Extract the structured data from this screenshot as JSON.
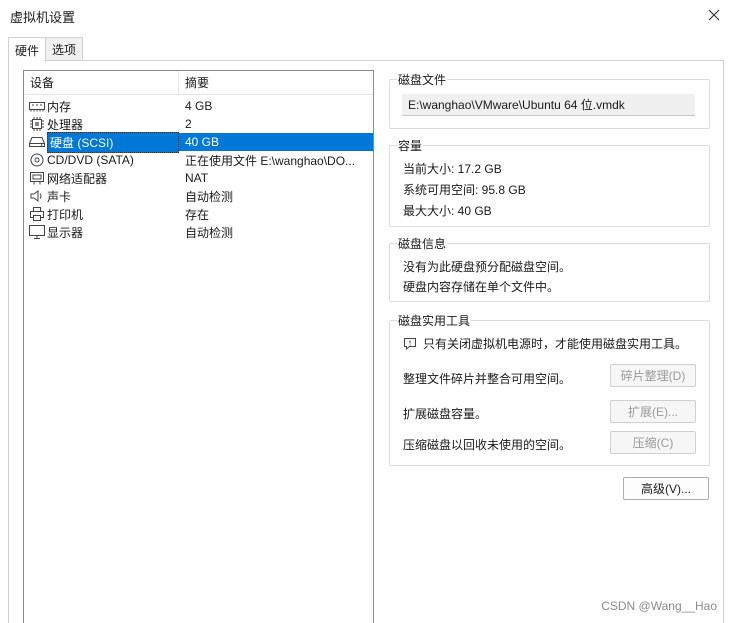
{
  "window": {
    "title": "虚拟机设置"
  },
  "tabs": [
    {
      "label": "硬件",
      "active": true
    },
    {
      "label": "选项",
      "active": false
    }
  ],
  "device_list": {
    "headers": {
      "device": "设备",
      "summary": "摘要"
    },
    "rows": [
      {
        "icon": "memory-icon",
        "device": "内存",
        "summary": "4 GB"
      },
      {
        "icon": "processor-icon",
        "device": "处理器",
        "summary": "2"
      },
      {
        "icon": "hard-disk-icon",
        "device": "硬盘 (SCSI)",
        "summary": "40 GB",
        "selected": true
      },
      {
        "icon": "cd-dvd-icon",
        "device": "CD/DVD (SATA)",
        "summary": "正在使用文件 E:\\wanghao\\DO..."
      },
      {
        "icon": "network-adapter-icon",
        "device": "网络适配器",
        "summary": "NAT"
      },
      {
        "icon": "sound-card-icon",
        "device": "声卡",
        "summary": "自动检测"
      },
      {
        "icon": "printer-icon",
        "device": "打印机",
        "summary": "存在"
      },
      {
        "icon": "display-icon",
        "device": "显示器",
        "summary": "自动检测"
      }
    ]
  },
  "disk_file": {
    "title": "磁盘文件",
    "path": "E:\\wanghao\\VMware\\Ubuntu 64 位.vmdk"
  },
  "capacity": {
    "title": "容量",
    "current_size": "当前大小: 17.2 GB",
    "available_space": "系统可用空间: 95.8 GB",
    "max_size": "最大大小: 40 GB"
  },
  "disk_info": {
    "title": "磁盘信息",
    "line1": "没有为此硬盘预分配磁盘空间。",
    "line2": "硬盘内容存储在单个文件中。"
  },
  "disk_utilities": {
    "title": "磁盘实用工具",
    "notice": "只有关闭虚拟机电源时，才能使用磁盘实用工具。",
    "defrag_desc": "整理文件碎片并整合可用空间。",
    "defrag_button": "碎片整理(D)",
    "expand_desc": "扩展磁盘容量。",
    "expand_button": "扩展(E)...",
    "compact_desc": "压缩磁盘以回收未使用的空间。",
    "compact_button": "压缩(C)"
  },
  "advanced_button": "高级(V)...",
  "watermark": "CSDN @Wang__Hao",
  "colors": {
    "selection": "#0078d7"
  }
}
